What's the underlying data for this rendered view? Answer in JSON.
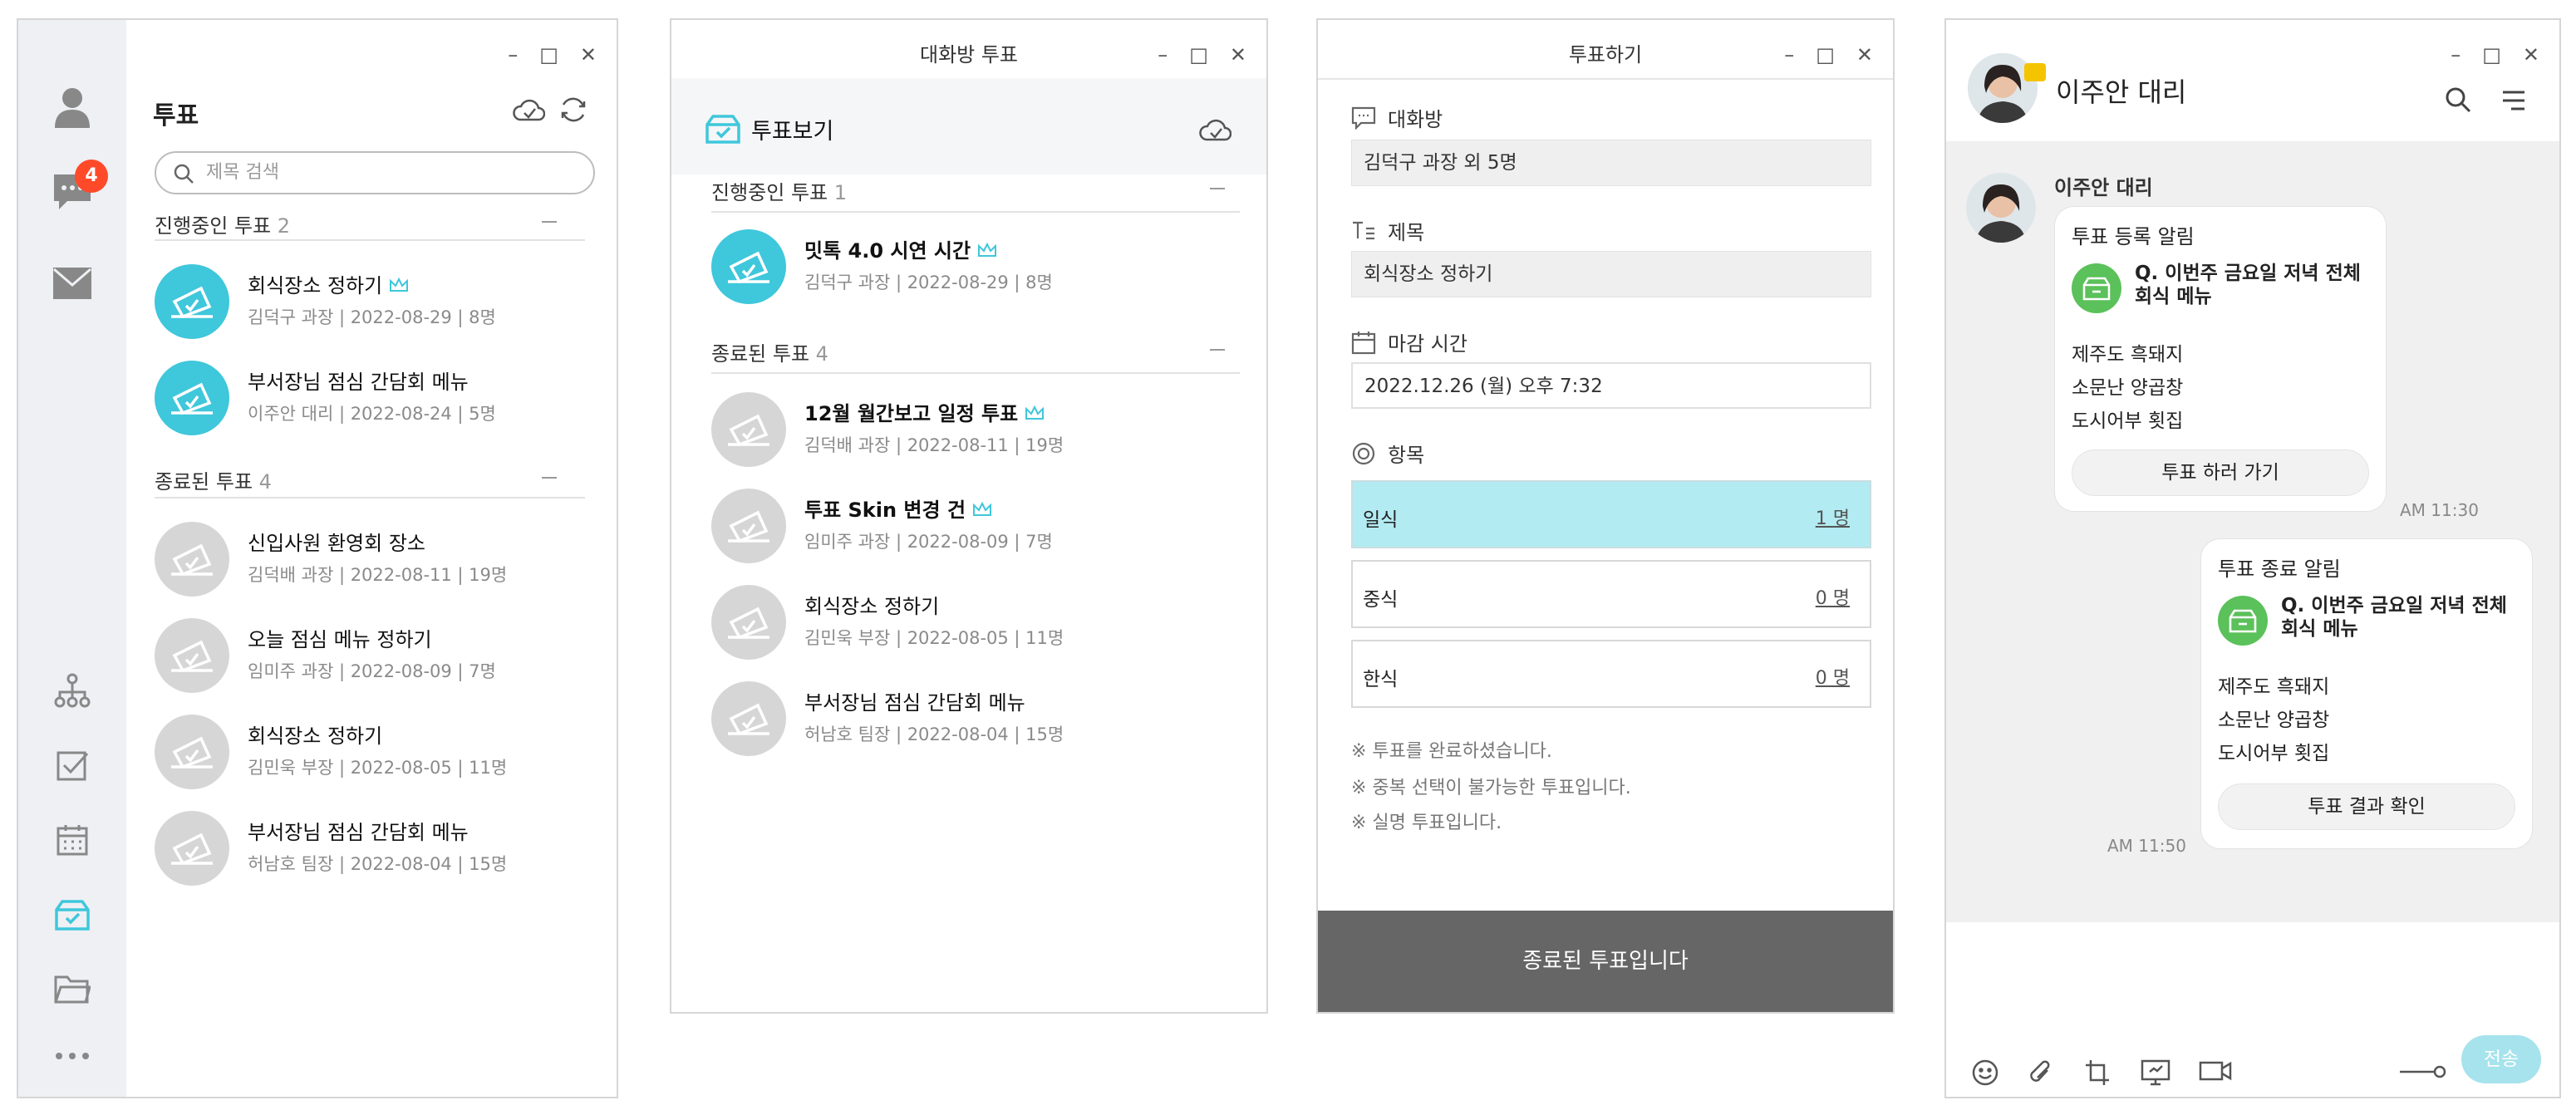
{
  "window_controls": {
    "minimize": "–",
    "maximize": "□",
    "close": "✕"
  },
  "panel1": {
    "title": "투표",
    "badge": "4",
    "search_placeholder": "제목 검색",
    "ongoing": {
      "label": "진행중인 투표",
      "count": "2"
    },
    "ended": {
      "label": "종료된 투표",
      "count": "4"
    },
    "ongoing_items": [
      {
        "title": "회식장소 정하기",
        "sub": "김덕구 과장 | 2022-08-29 | 8명"
      },
      {
        "title": "부서장님 점심 간담회 메뉴",
        "sub": "이주안 대리 | 2022-08-24 | 5명"
      }
    ],
    "ended_items": [
      {
        "title": "신입사원 환영회 장소",
        "sub": "김덕배 과장 | 2022-08-11 | 19명"
      },
      {
        "title": "오늘 점심 메뉴 정하기",
        "sub": "임미주 과장 | 2022-08-09 | 7명"
      },
      {
        "title": "회식장소 정하기",
        "sub": "김민욱 부장 | 2022-08-05 | 11명"
      },
      {
        "title": "부서장님 점심 간담회 메뉴",
        "sub": "허남호 팀장 | 2022-08-04 | 15명"
      }
    ]
  },
  "panel2": {
    "window_title": "대화방 투표",
    "header": "투표보기",
    "ongoing": {
      "label": "진행중인 투표",
      "count": "1"
    },
    "ended": {
      "label": "종료된 투표",
      "count": "4"
    },
    "ongoing_items": [
      {
        "title": "밋톡 4.0 시연 시간",
        "sub": "김덕구 과장 | 2022-08-29 | 8명"
      }
    ],
    "ended_items": [
      {
        "title": "12월 월간보고 일정 투표",
        "sub": "김덕배 과장 | 2022-08-11 | 19명"
      },
      {
        "title": "투표 Skin 변경 건",
        "sub": "임미주 과장 | 2022-08-09 | 7명"
      },
      {
        "title": "회식장소 정하기",
        "sub": "김민욱 부장 | 2022-08-05 | 11명"
      },
      {
        "title": "부서장님 점심 간담회 메뉴",
        "sub": "허남호 팀장 | 2022-08-04 | 15명"
      }
    ]
  },
  "panel3": {
    "window_title": "투표하기",
    "room_label": "대화방",
    "room_value": "김덕구 과장 외 5명",
    "subject_label": "제목",
    "subject_value": "회식장소 정하기",
    "deadline_label": "마감 시간",
    "deadline_value": "2022.12.26 (월) 오후  7:32",
    "items_label": "항목",
    "options": [
      {
        "name": "일식",
        "count": "1 명"
      },
      {
        "name": "중식",
        "count": "0 명"
      },
      {
        "name": "한식",
        "count": "0 명"
      }
    ],
    "notes": [
      "※ 투표를 완료하셨습니다.",
      "※ 중복 선택이 불가능한 투표입니다.",
      "※ 실명 투표입니다."
    ],
    "ended_banner": "종료된 투표입니다"
  },
  "panel4": {
    "contact": "이주안 대리",
    "sender": "이주안 대리",
    "msg1": {
      "header": "투표 등록 알림",
      "q": "Q. 이번주 금요일 저녁 전체 회식 메뉴",
      "lines": [
        "제주도 흑돼지",
        "소문난 양곱창",
        "도시어부 횟집"
      ],
      "button": "투표 하러 가기",
      "time": "AM 11:30"
    },
    "msg2": {
      "header": "투표 종료 알림",
      "q": "Q. 이번주 금요일 저녁 전체 회식 메뉴",
      "lines": [
        "제주도 흑돼지",
        "소문난 양곱창",
        "도시어부 횟집"
      ],
      "button": "투표 결과 확인",
      "time": "AM 11:50"
    },
    "send_label": "전송"
  },
  "colors": {
    "accent": "#3fc7db",
    "badge": "#ff4a2a",
    "selected_option": "#b3ebf2",
    "vote_green": "#5bc15a",
    "ended_bar": "#666666"
  }
}
